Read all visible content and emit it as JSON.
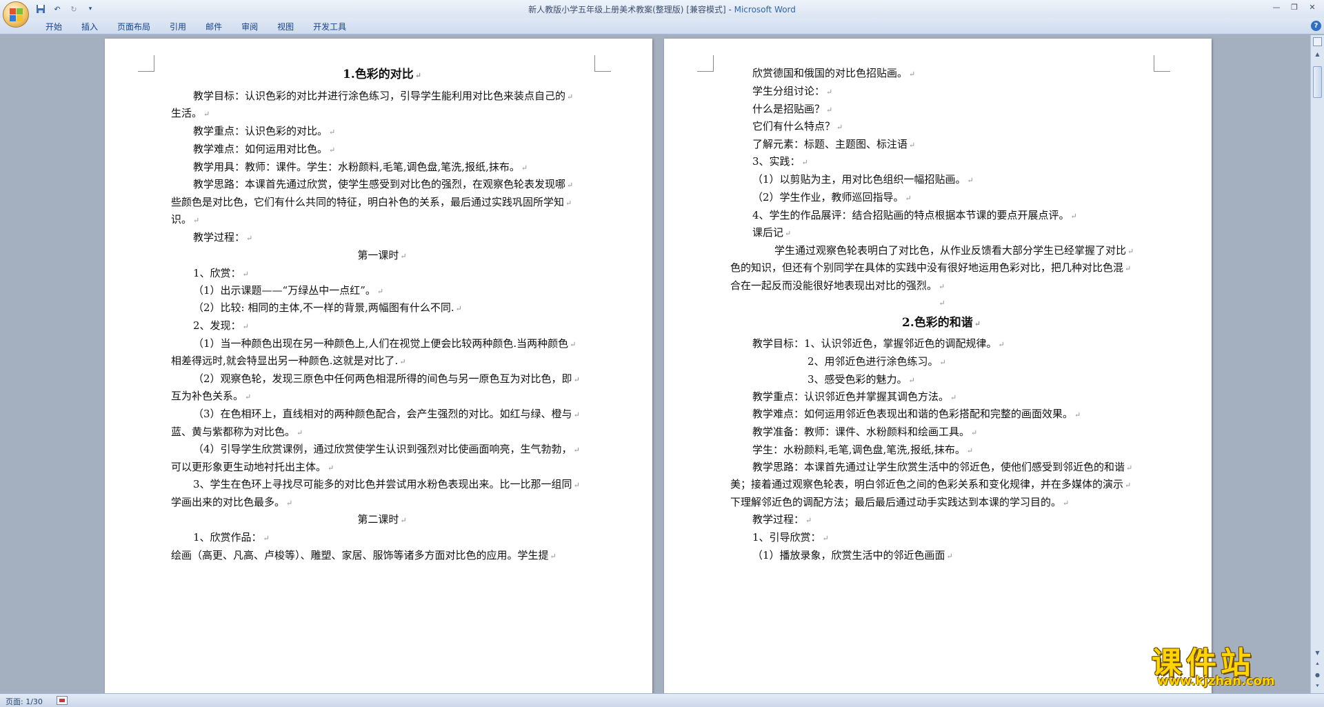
{
  "window": {
    "title_doc": "新人教版小学五年级上册美术教案(整理版) [兼容模式] - ",
    "title_app": "Microsoft Word"
  },
  "quick_access": {
    "save_icon": "save-icon",
    "undo_icon": "undo-icon",
    "redo_icon": "redo-icon"
  },
  "ribbon": {
    "tabs": [
      "开始",
      "插入",
      "页面布局",
      "引用",
      "邮件",
      "审阅",
      "视图",
      "开发工具"
    ]
  },
  "page1": {
    "lines": [
      "1.色彩的对比",
      "教学目标：认识色彩的对比并进行涂色练习，引导学生能利用对比色来装点自己的",
      "生活。",
      "教学重点：认识色彩的对比。",
      "教学难点：如何运用对比色。",
      "教学用具：教师：课件。学生：水粉颜料,毛笔,调色盘,笔洗,报纸,抹布。",
      "教学思路：本课首先通过欣赏，使学生感受到对比色的强烈，在观察色轮表发现哪",
      "些颜色是对比色，它们有什么共同的特征，明白补色的关系，最后通过实践巩固所学知",
      "识。",
      "教学过程：",
      "第一课时",
      "1、欣赏：",
      "（1）出示课题——“万绿丛中一点红”。",
      "（2）比较: 相同的主体,不一样的背景,两幅图有什么不同.",
      "2、发现：",
      "（1）当一种颜色出现在另一种颜色上,人们在视觉上便会比较两种颜色.当两种颜色",
      "相差得远时,就会特显出另一种颜色.这就是对比了.",
      "（2）观察色轮，发现三原色中任何两色相混所得的间色与另一原色互为对比色，即",
      "互为补色关系。",
      "（3）在色相环上，直线相对的两种颜色配合，会产生强烈的对比。如红与绿、橙与",
      "蓝、黄与紫都称为对比色。",
      "（4）引导学生欣赏课例，通过欣赏使学生认识到强烈对比使画面响亮，生气勃勃，",
      "可以更形象更生动地衬托出主体。",
      "3、学生在色环上寻找尽可能多的对比色并尝试用水粉色表现出来。比一比那一组同",
      "学画出来的对比色最多。",
      "第二课时",
      "1、欣赏作品：",
      "绘画（高更、凡高、卢梭等）、雕塑、家居、服饰等诸多方面对比色的应用。学生提"
    ]
  },
  "page2": {
    "lines": [
      "欣赏德国和俄国的对比色招贴画。",
      "学生分组讨论：",
      "什么是招贴画？",
      "它们有什么特点？",
      "了解元素：标题、主题图、标注语",
      "3、实践：",
      "（1）以剪贴为主，用对比色组织一幅招贴画。",
      "（2）学生作业，教师巡回指导。",
      "4、学生的作品展评：结合招贴画的特点根据本节课的要点开展点评。",
      "课后记",
      "学生通过观察色轮表明白了对比色，从作业反馈看大部分学生已经掌握了对比",
      "色的知识，但还有个别同学在具体的实践中没有很好地运用色彩对比，把几种对比色混",
      "合在一起反而没能很好地表现出对比的强烈。",
      "",
      "2.色彩的和谐",
      "教学目标：1、认识邻近色，掌握邻近色的调配规律。",
      "2、用邻近色进行涂色练习。",
      "3、感受色彩的魅力。",
      "教学重点：认识邻近色并掌握其调色方法。",
      "教学难点：如何运用邻近色表现出和谐的色彩搭配和完整的画面效果。",
      "教学准备：教师：课件、水粉颜料和绘画工具。",
      "学生：水粉颜料,毛笔,调色盘,笔洗,报纸,抹布。",
      "教学思路：本课首先通过让学生欣赏生活中的邻近色，使他们感受到邻近色的和谐",
      "美；接着通过观察色轮表，明白邻近色之间的色彩关系和变化规律，并在多媒体的演示",
      "下理解邻近色的调配方法；最后最后通过动手实践达到本课的学习目的。",
      "教学过程：",
      "1、引导欣赏：",
      "（1）播放录象，欣赏生活中的邻近色画面"
    ]
  },
  "statusbar": {
    "page_info": "页面: 1/30"
  },
  "watermark": {
    "big": "课件站",
    "small": "www.kjzhan.com"
  }
}
